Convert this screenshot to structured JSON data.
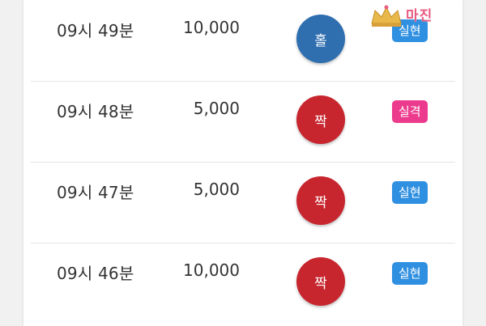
{
  "watermark": {
    "text": "마진",
    "subtitle": ""
  },
  "rows": [
    {
      "time": "09시 49분",
      "amount": "10,000",
      "ball": "홀",
      "ball_color": "#2f6fb0",
      "result": "실현",
      "result_color": "#2f8fe0"
    },
    {
      "time": "09시 48분",
      "amount": "5,000",
      "ball": "짝",
      "ball_color": "#c8262e",
      "result": "실격",
      "result_color": "#ec3a8c"
    },
    {
      "time": "09시 47분",
      "amount": "5,000",
      "ball": "짝",
      "ball_color": "#c8262e",
      "result": "실현",
      "result_color": "#2f8fe0"
    },
    {
      "time": "09시 46분",
      "amount": "10,000",
      "ball": "짝",
      "ball_color": "#c8262e",
      "result": "실현",
      "result_color": "#2f8fe0"
    }
  ]
}
